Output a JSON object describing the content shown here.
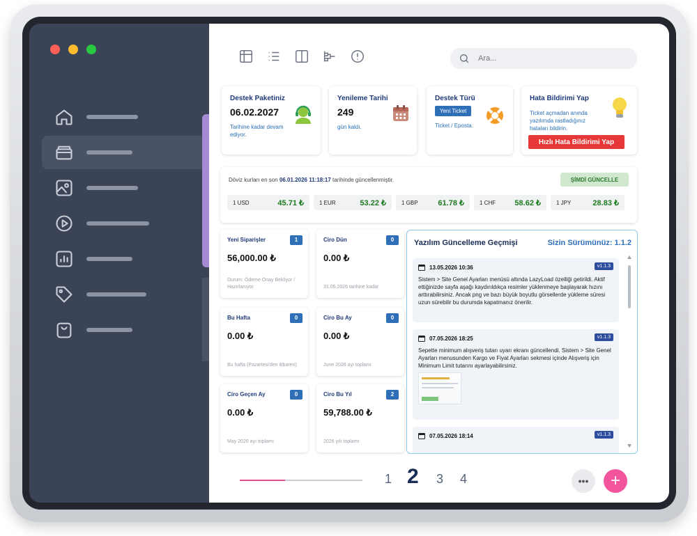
{
  "colors": {
    "sidebar": "#3b4457",
    "accent_pink": "#e84b96",
    "accent_blue": "#2e6fb8",
    "red": "#e63838",
    "green": "#1e7a1e"
  },
  "window": {
    "dots": [
      "#ff5f57",
      "#febc2e",
      "#28c840"
    ]
  },
  "sidebar": {
    "items": [
      "home-icon",
      "wallet-icon",
      "image-icon",
      "play-icon",
      "chart-icon",
      "tag-icon",
      "bag-icon"
    ],
    "active_index": 1
  },
  "toolbar": {
    "icons": [
      "table-icon",
      "list-icon",
      "columns-icon",
      "hierarchy-icon",
      "alert-icon"
    ]
  },
  "search": {
    "placeholder": "Ara..."
  },
  "cards": {
    "support": {
      "title": "Destek Paketiniz",
      "value": "06.02.2027",
      "note": "Tarihine kadar devam ediyor."
    },
    "renewal": {
      "title": "Yenileme Tarihi",
      "value": "249",
      "note": "gün kaldı."
    },
    "type": {
      "title": "Destek Türü",
      "badge": "Yeni Ticket",
      "note": "Ticket / Eposta."
    },
    "bug": {
      "title": "Hata Bildirimi Yap",
      "note": "Ticket açmadan anında yazılımda rastladığınız hataları bildirin.",
      "button": "Hızlı Hata Bildirimi Yap"
    }
  },
  "currency": {
    "text_prefix": "Döviz kurları en son",
    "timestamp": "06.01.2026 11:18:17",
    "text_suffix": "tarihinde güncellenmiştir.",
    "update_button": "ŞİMDİ GÜNCELLE",
    "rates": [
      {
        "code": "1 USD",
        "value": "45.71 ₺"
      },
      {
        "code": "1 EUR",
        "value": "53.22 ₺"
      },
      {
        "code": "1 GBP",
        "value": "61.78 ₺"
      },
      {
        "code": "1 CHF",
        "value": "58.62 ₺"
      },
      {
        "code": "1 JPY",
        "value": "28.83 ₺"
      }
    ]
  },
  "stats": [
    {
      "title": "Yeni Siparişler",
      "count": "1",
      "value": "56,000.00 ₺",
      "note": "Durum: Ödeme Onay Bekliyor / Hazırlanıyor"
    },
    {
      "title": "Ciro Dün",
      "count": "0",
      "value": "0.00 ₺",
      "note": "31.05.2026 tarihine kadar"
    },
    {
      "title": "Bu Hafta",
      "count": "0",
      "value": "0.00 ₺",
      "note": "Bu hafta (Pazartesi'den itibaren)"
    },
    {
      "title": "Ciro Bu Ay",
      "count": "0",
      "value": "0.00 ₺",
      "note": "June 2026 ayı toplamı"
    },
    {
      "title": "Ciro Geçen Ay",
      "count": "0",
      "value": "0.00 ₺",
      "note": "May 2026 ayı toplamı"
    },
    {
      "title": "Ciro Bu Yıl",
      "count": "2",
      "value": "59,788.00 ₺",
      "note": "2026 yılı toplamı"
    }
  ],
  "updates": {
    "title": "Yazılım Güncelleme Geçmişi",
    "version": "Sizin Sürümünüz: 1.1.2",
    "entries": [
      {
        "date": "13.05.2026 10:36",
        "tag": "v1.1.3",
        "text": "Sistem > Site Genel Ayarları menüsü altında LazyLoad özelliği getirildi. Aktif ettiğinizde sayfa aşağı kaydırıldıkça resimler yüklenmeye başlayarak hızını arttırabilirsiniz. Ancak png ve bazı büyük boyutlu görsellerde yükleme süresi uzun sürebilir bu durumda kapatmanız önerilir."
      },
      {
        "date": "07.05.2026 18:25",
        "tag": "v1.1.3",
        "text": "Sepette minimum alışveriş tutarı uyarı ekranı güncellendi. Sistem > Site Genel Ayarları menusunden Kargo ve Fiyat Ayarları sekmesi içinde Alışveriş için Minimum Limit tutarını ayarlayabilirsiniz."
      },
      {
        "date": "07.05.2026 18:14",
        "tag": "v1.1.3",
        "text": ""
      }
    ]
  },
  "pager": {
    "pages": [
      "1",
      "2",
      "3",
      "4"
    ],
    "active": "2",
    "progress": 0.37,
    "more_label": "•••",
    "add_label": "+"
  }
}
